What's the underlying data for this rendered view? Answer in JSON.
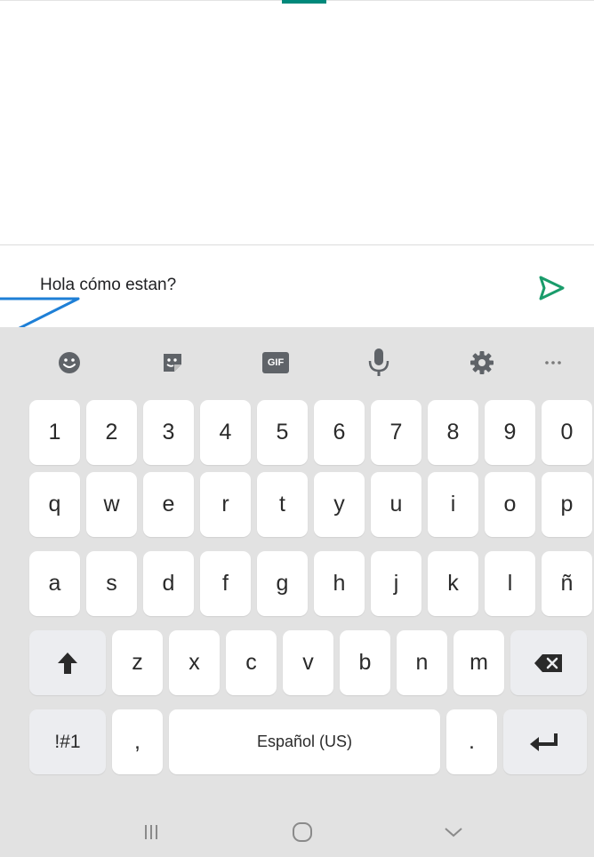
{
  "compose": {
    "text": "Hola cómo estan?"
  },
  "icons": {
    "send": "send-icon",
    "emoji": "emoji-icon",
    "sticker": "sticker-icon",
    "gif": "gif-icon",
    "mic": "microphone-icon",
    "settings": "gear-icon",
    "more": "more-icon"
  },
  "toolbar": {
    "gif_label": "GIF"
  },
  "keyboard": {
    "rows": [
      [
        "1",
        "2",
        "3",
        "4",
        "5",
        "6",
        "7",
        "8",
        "9",
        "0"
      ],
      [
        "q",
        "w",
        "e",
        "r",
        "t",
        "y",
        "u",
        "i",
        "o",
        "p"
      ],
      [
        "a",
        "s",
        "d",
        "f",
        "g",
        "h",
        "j",
        "k",
        "l",
        "ñ"
      ],
      [
        "z",
        "x",
        "c",
        "v",
        "b",
        "n",
        "m"
      ]
    ],
    "symbols_label": "!#1",
    "comma_label": ",",
    "space_label": "Español (US)",
    "period_label": "."
  },
  "colors": {
    "accent": "#00897b",
    "send": "#1a9c6b",
    "annotation": "#1e7fd6",
    "keyboard_bg": "#e2e2e2",
    "key_bg": "#ffffff",
    "func_key_bg": "#ecedf0"
  }
}
